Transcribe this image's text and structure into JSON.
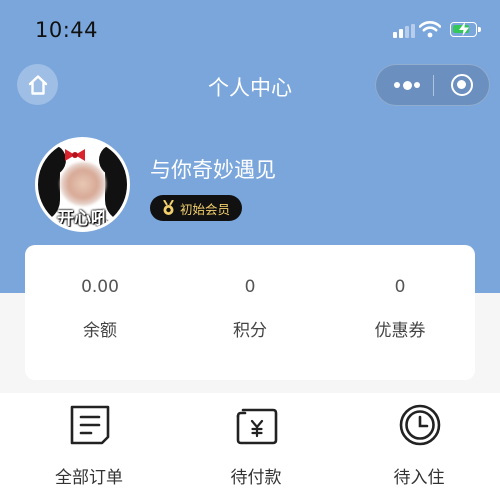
{
  "status_bar": {
    "time": "10:44",
    "icons": [
      "signal-icon",
      "wifi-icon",
      "battery-charging-icon"
    ]
  },
  "nav": {
    "title": "个人中心",
    "home_icon": "home-icon",
    "more_icon": "more-dots-icon",
    "close_icon": "target-circle-icon"
  },
  "profile": {
    "avatar_text": "开心吼",
    "username": "与你奇妙遇见",
    "member_level": "初始会员",
    "member_icon": "medal-icon"
  },
  "stats": [
    {
      "value": "0.00",
      "label": "余额"
    },
    {
      "value": "0",
      "label": "积分"
    },
    {
      "value": "0",
      "label": "优惠券"
    }
  ],
  "orders": [
    {
      "label": "全部订单",
      "icon": "order-list-icon"
    },
    {
      "label": "待付款",
      "icon": "wallet-yen-icon"
    },
    {
      "label": "待入住",
      "icon": "clock-icon"
    }
  ],
  "colors": {
    "header_bg": "#7aa6db",
    "badge_text": "#f2cf6d",
    "battery_fill": "#34c759"
  }
}
